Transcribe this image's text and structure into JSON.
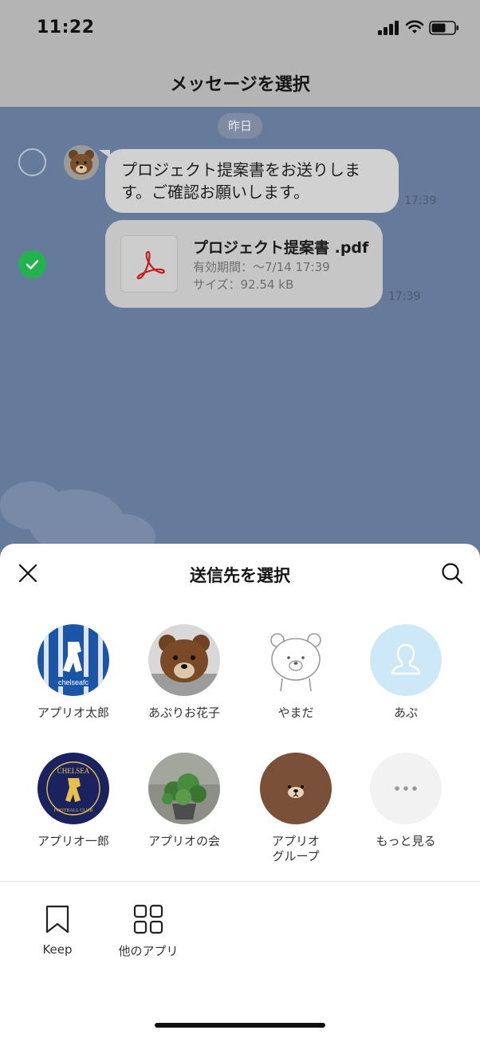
{
  "status_bar": {
    "time": "11:22"
  },
  "header": {
    "title": "メッセージを選択"
  },
  "chat": {
    "date_chip": "昨日",
    "messages": [
      {
        "text": "プロジェクト提案書をお送りします。ご確認お願いします。",
        "time": "17:39",
        "selected": false
      },
      {
        "file_name": "プロジェクト提案書 .pdf",
        "expiry": "有効期間：〜7/14 17:39",
        "size": "サイズ：92.54 kB",
        "time": "17:39",
        "selected": true
      }
    ]
  },
  "share_sheet": {
    "title": "送信先を選択",
    "contacts": [
      {
        "name": "アプリオ太郎"
      },
      {
        "name": "あぷりお花子"
      },
      {
        "name": "やまだ"
      },
      {
        "name": "あぷ"
      },
      {
        "name": "アプリオ一郎"
      },
      {
        "name": "アプリオの会"
      },
      {
        "name": "アプリオ\nグループ"
      },
      {
        "name": "もっと見る"
      }
    ],
    "apps": [
      {
        "label": "Keep"
      },
      {
        "label": "他のアプリ"
      }
    ]
  },
  "colors": {
    "accent_green": "#22b34c",
    "chat_bg": "#667a9c",
    "header_bg": "#b4b4b4",
    "default_avatar_bg": "#cde8f6",
    "brown": "#7a5138"
  }
}
